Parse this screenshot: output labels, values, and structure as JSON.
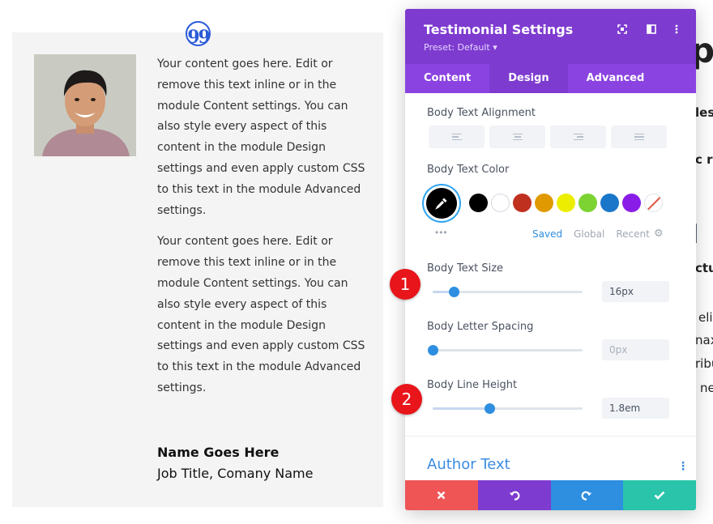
{
  "testimonial": {
    "paragraphs": [
      "Your content goes here. Edit or remove this text inline or in the module Content settings. You can also style every aspect of this content in the module Design settings and even apply custom CSS to this text in the module Advanced settings.",
      "Your content goes here. Edit or remove this text inline or in the module Content settings. You can also style every aspect of this content in the module Design settings and even apply custom CSS to this text in the module Advanced settings."
    ],
    "author_name": "Name Goes Here",
    "author_job": "Job Title, Comany Name",
    "quote_glyph": "99"
  },
  "background_fragments": [
    "p",
    "les",
    "c r",
    "ctu",
    "eli",
    "nax",
    "ribu",
    "ne"
  ],
  "panel": {
    "title": "Testimonial Settings",
    "preset": "Preset: Default ▾",
    "tabs": [
      "Content",
      "Design",
      "Advanced"
    ],
    "active_tab": "Design",
    "body_text_alignment_label": "Body Text Alignment",
    "body_text_color_label": "Body Text Color",
    "swatch_colors": [
      "#000000",
      "#ffffff",
      "#c0301f",
      "#e09900",
      "#eded00",
      "#7cd332",
      "#1a76c9",
      "#8a1ce8"
    ],
    "color_tabs": [
      "Saved",
      "Global",
      "Recent"
    ],
    "active_color_tab": "Saved",
    "body_text_size": {
      "label": "Body Text Size",
      "value": "16px",
      "slider_fraction": 0.14
    },
    "body_letter_spacing": {
      "label": "Body Letter Spacing",
      "value": "0px",
      "slider_fraction": 0.0
    },
    "body_line_height": {
      "label": "Body Line Height",
      "value": "1.8em",
      "slider_fraction": 0.38
    },
    "author_text_label": "Author Text",
    "badges": [
      "1",
      "2"
    ],
    "footer_colors": {
      "cancel": "#ef5555",
      "undo": "#7e3bd0",
      "redo": "#2e8ee0",
      "save": "#29c4a9"
    }
  }
}
